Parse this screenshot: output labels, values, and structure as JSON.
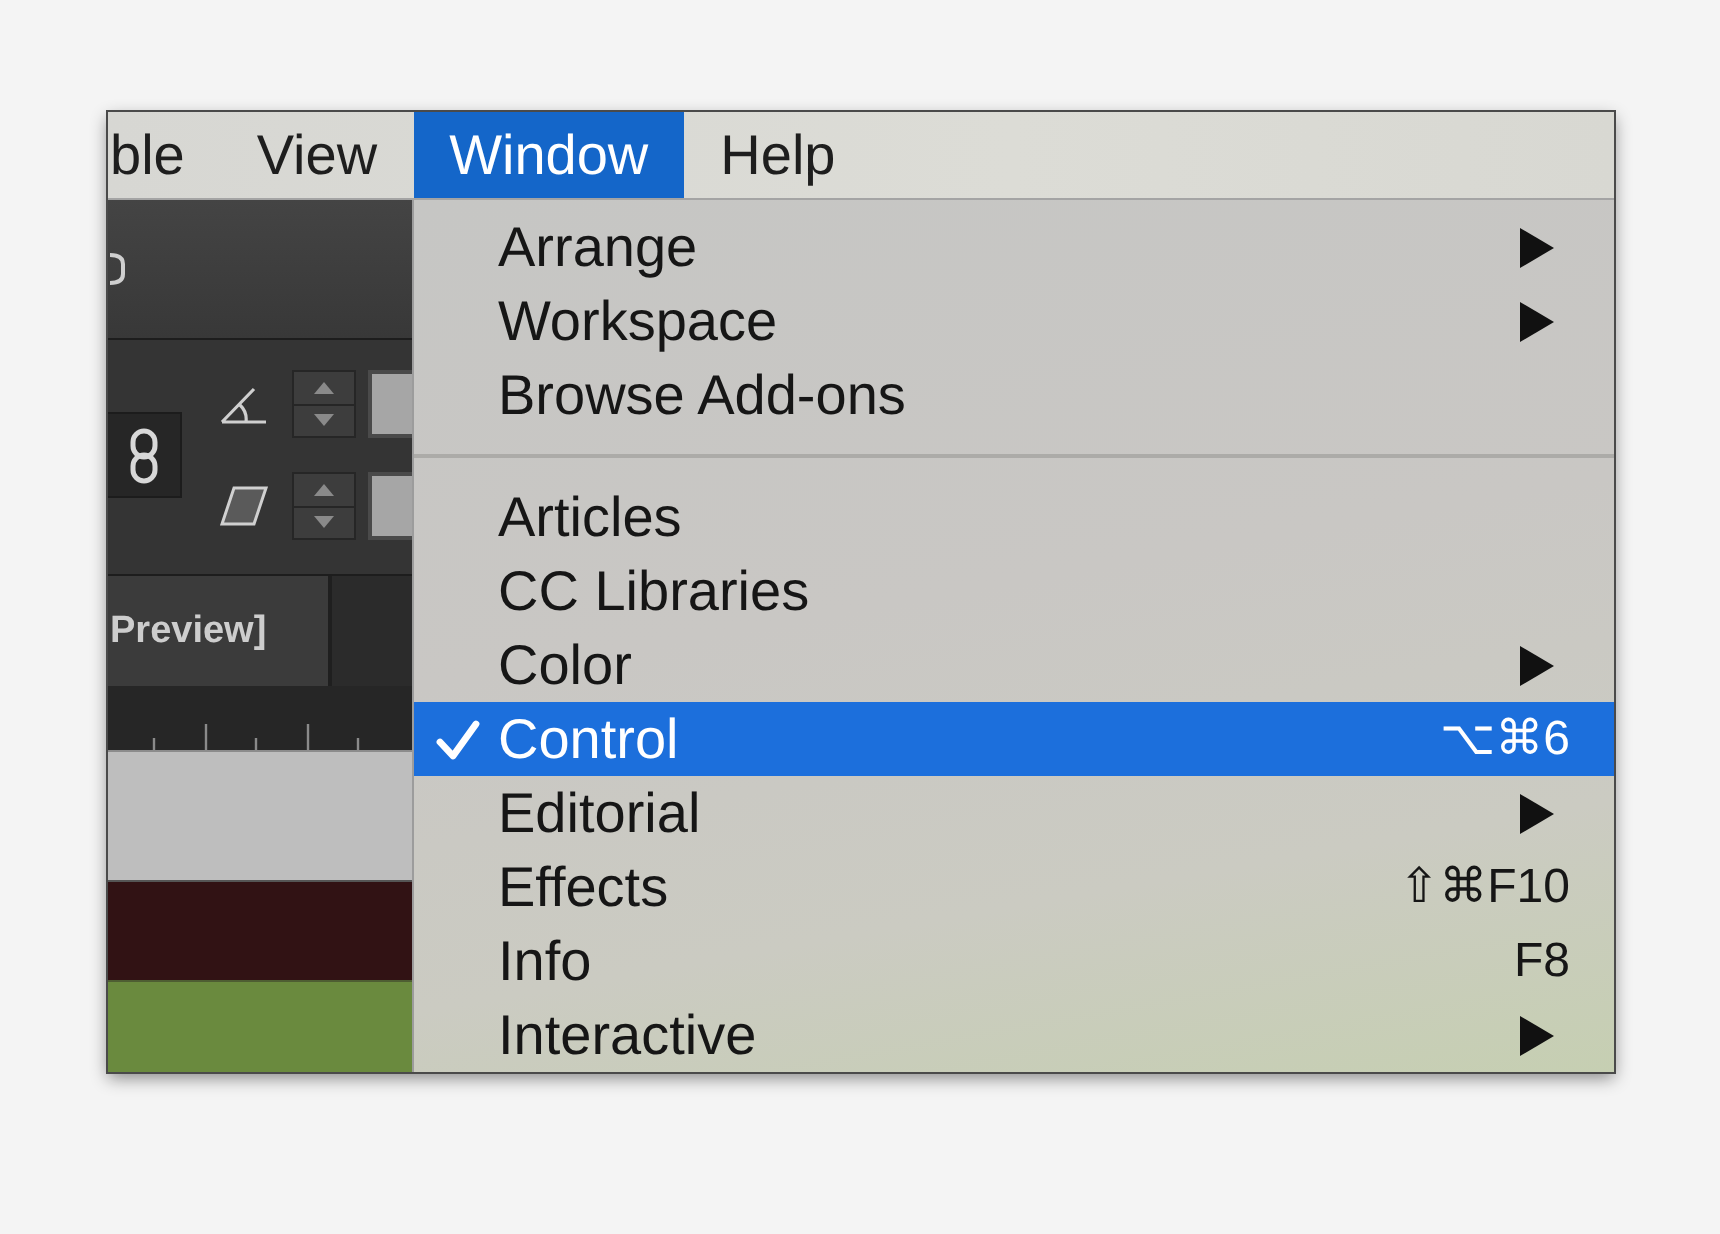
{
  "menu_bar": {
    "items": [
      {
        "label": "ble",
        "selected": false
      },
      {
        "label": "View",
        "selected": false
      },
      {
        "label": "Window",
        "selected": true
      },
      {
        "label": "Help",
        "selected": false
      }
    ]
  },
  "background_app": {
    "tab": {
      "label": "Preview]"
    }
  },
  "dropdown_menu": {
    "items": [
      {
        "kind": "item",
        "label": "Arrange",
        "checked": false,
        "selected": false,
        "submenu": true
      },
      {
        "kind": "item",
        "label": "Workspace",
        "checked": false,
        "selected": false,
        "submenu": true
      },
      {
        "kind": "item",
        "label": "Browse Add-ons",
        "checked": false,
        "selected": false,
        "submenu": false
      },
      {
        "kind": "separator"
      },
      {
        "kind": "item",
        "label": "Articles",
        "checked": false,
        "selected": false,
        "submenu": false
      },
      {
        "kind": "item",
        "label": "CC Libraries",
        "checked": false,
        "selected": false,
        "submenu": false
      },
      {
        "kind": "item",
        "label": "Color",
        "checked": false,
        "selected": false,
        "submenu": true
      },
      {
        "kind": "item",
        "label": "Control",
        "checked": true,
        "selected": true,
        "submenu": false,
        "shortcut": "⌥⌘6"
      },
      {
        "kind": "item",
        "label": "Editorial",
        "checked": false,
        "selected": false,
        "submenu": true
      },
      {
        "kind": "item",
        "label": "Effects",
        "checked": false,
        "selected": false,
        "submenu": false,
        "shortcut": "⇧⌘F10"
      },
      {
        "kind": "item",
        "label": "Info",
        "checked": false,
        "selected": false,
        "submenu": false,
        "shortcut": "F8"
      },
      {
        "kind": "item",
        "label": "Interactive",
        "checked": false,
        "selected": false,
        "submenu": true
      }
    ]
  }
}
